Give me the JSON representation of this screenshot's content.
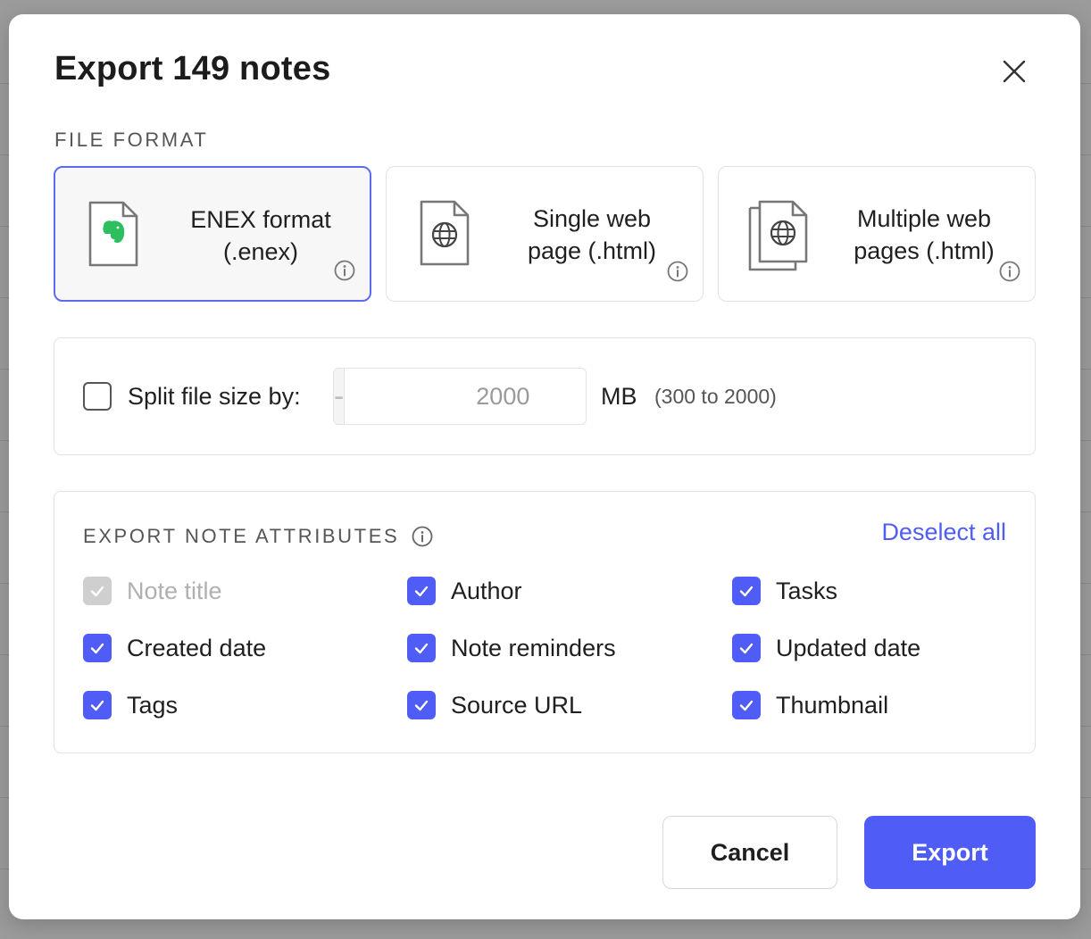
{
  "dialog": {
    "title": "Export 149 notes",
    "close_icon": "close-icon"
  },
  "file_format": {
    "section_label": "FILE FORMAT",
    "options": [
      {
        "label_line1": "ENEX format",
        "label_line2": "(.enex)",
        "icon": "evernote-file-icon",
        "selected": true
      },
      {
        "label_line1": "Single web",
        "label_line2": "page (.html)",
        "icon": "globe-file-icon",
        "selected": false
      },
      {
        "label_line1": "Multiple web",
        "label_line2": "pages (.html)",
        "icon": "multiple-globe-files-icon",
        "selected": false
      }
    ]
  },
  "split": {
    "label": "Split file size by:",
    "checked": false,
    "minus": "-",
    "plus": "+",
    "value": "2000",
    "unit": "MB",
    "range": "(300 to 2000)"
  },
  "attributes": {
    "section_label": "EXPORT NOTE ATTRIBUTES",
    "deselect_all": "Deselect all",
    "items": [
      {
        "label": "Note title",
        "checked": true,
        "disabled": true
      },
      {
        "label": "Author",
        "checked": true,
        "disabled": false
      },
      {
        "label": "Tasks",
        "checked": true,
        "disabled": false
      },
      {
        "label": "Created date",
        "checked": true,
        "disabled": false
      },
      {
        "label": "Note reminders",
        "checked": true,
        "disabled": false
      },
      {
        "label": "Updated date",
        "checked": true,
        "disabled": false
      },
      {
        "label": "Tags",
        "checked": true,
        "disabled": false
      },
      {
        "label": "Source URL",
        "checked": true,
        "disabled": false
      },
      {
        "label": "Thumbnail",
        "checked": true,
        "disabled": false
      }
    ]
  },
  "actions": {
    "cancel": "Cancel",
    "export": "Export"
  },
  "colors": {
    "accent": "#4f5cf5",
    "evernote_green": "#2dbe60",
    "overlay": "#9b9b9b"
  }
}
